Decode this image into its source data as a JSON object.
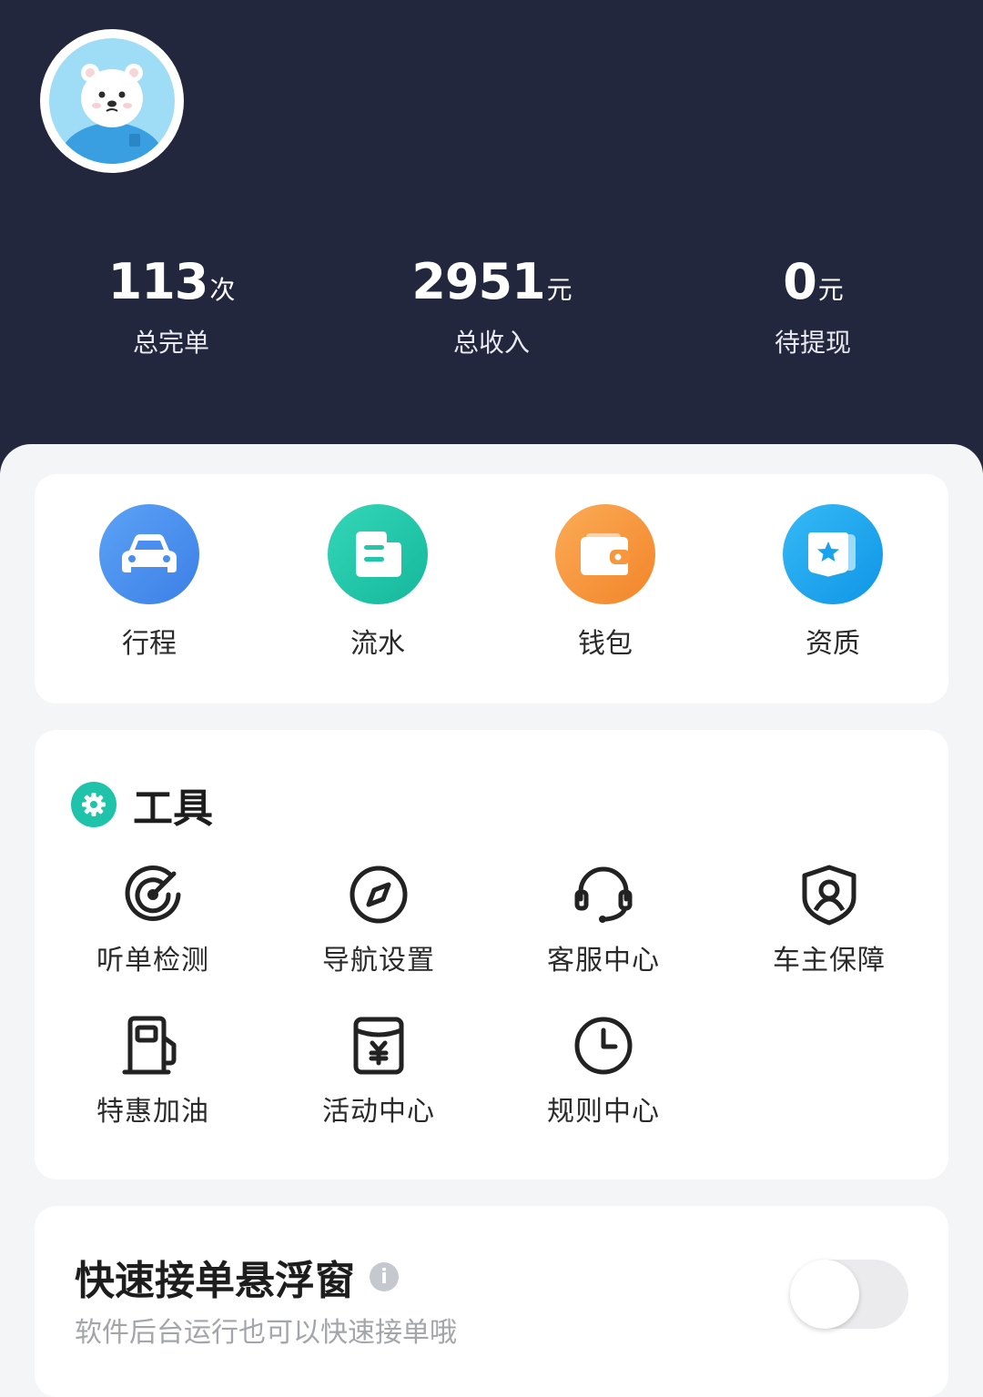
{
  "stats": [
    {
      "value": "113",
      "unit": "次",
      "label": "总完单"
    },
    {
      "value": "2951",
      "unit": "元",
      "label": "总收入"
    },
    {
      "value": "0",
      "unit": "元",
      "label": "待提现"
    }
  ],
  "quick_actions": [
    {
      "label": "行程",
      "icon": "car-icon",
      "color": "#4a8ff0"
    },
    {
      "label": "流水",
      "icon": "document-icon",
      "color": "#22c6a8"
    },
    {
      "label": "钱包",
      "icon": "wallet-icon",
      "color": "#f7963c"
    },
    {
      "label": "资质",
      "icon": "star-badge-icon",
      "color": "#17a3ee"
    }
  ],
  "tools": {
    "title": "工具",
    "items": [
      {
        "label": "听单检测",
        "icon": "radar-icon"
      },
      {
        "label": "导航设置",
        "icon": "compass-icon"
      },
      {
        "label": "客服中心",
        "icon": "headset-icon"
      },
      {
        "label": "车主保障",
        "icon": "shield-user-icon"
      },
      {
        "label": "特惠加油",
        "icon": "fuel-pump-icon"
      },
      {
        "label": "活动中心",
        "icon": "event-calendar-icon"
      },
      {
        "label": "规则中心",
        "icon": "clock-icon"
      }
    ]
  },
  "floating_window": {
    "title": "快速接单悬浮窗",
    "subtitle": "软件后台运行也可以快速接单哦",
    "enabled": false
  },
  "colors": {
    "header_bg": "#23273d",
    "page_bg": "#f4f5f7",
    "tools_accent": "#1ec3a9"
  }
}
